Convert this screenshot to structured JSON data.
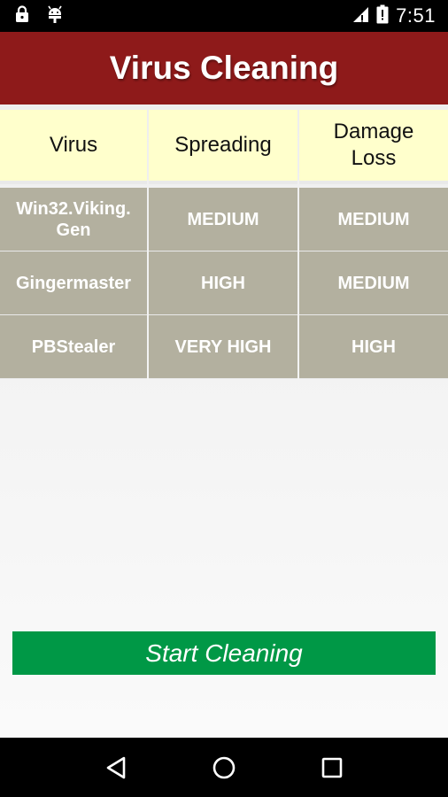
{
  "status_bar": {
    "time": "7:51",
    "icons": [
      "lock-icon",
      "android-debug-icon",
      "signal-icon",
      "battery-icon"
    ]
  },
  "app_bar": {
    "title": "Virus Cleaning",
    "background": "#8e1a1a"
  },
  "table": {
    "headers": [
      "Virus",
      "Spreading",
      "Damage Loss"
    ],
    "rows": [
      [
        "Win32.Viking.\nGen",
        "MEDIUM",
        "MEDIUM"
      ],
      [
        "Gingermaster",
        "HIGH",
        "MEDIUM"
      ],
      [
        "PBStealer",
        "VERY HIGH",
        "HIGH"
      ]
    ],
    "header_color": "#ffffcc",
    "cell_color": "#b3b09f"
  },
  "actions": {
    "start_label": "Start Cleaning",
    "start_color": "#009846"
  },
  "nav_bar": {
    "icons": [
      "back-icon",
      "home-icon",
      "recents-icon"
    ]
  }
}
